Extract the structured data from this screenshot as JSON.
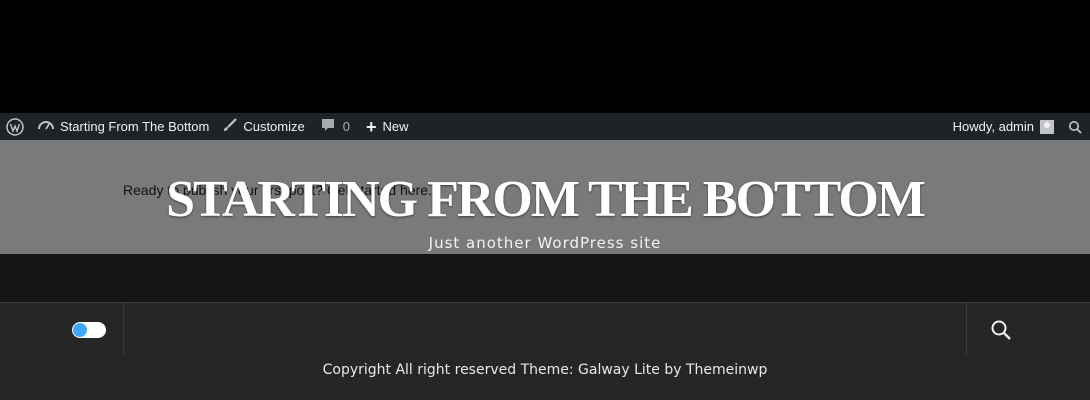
{
  "admin_bar": {
    "site_name": "Starting From The Bottom",
    "customize_label": "Customize",
    "comments_count": "0",
    "new_label": "New",
    "howdy_text": "Howdy, admin"
  },
  "hero": {
    "underlying_text": "Ready to publish your first post? Get started here.",
    "site_title": "STARTING FROM THE BOTTOM",
    "tagline": "Just another WordPress site"
  },
  "nav": {
    "toggle_state": "on"
  },
  "footer": {
    "copyright": "Copyright All right reserved Theme: Galway Lite by Themeinwp"
  },
  "colors": {
    "admin_bar_bg": "#1d2327",
    "hero_bg": "#7a7a7a",
    "nav_bg": "#262626",
    "toggle_accent": "#3ea6ff"
  },
  "icons": [
    "wordpress-logo-icon",
    "dashboard-icon",
    "paintbrush-icon",
    "comment-icon",
    "plus-icon",
    "avatar",
    "search-icon"
  ]
}
